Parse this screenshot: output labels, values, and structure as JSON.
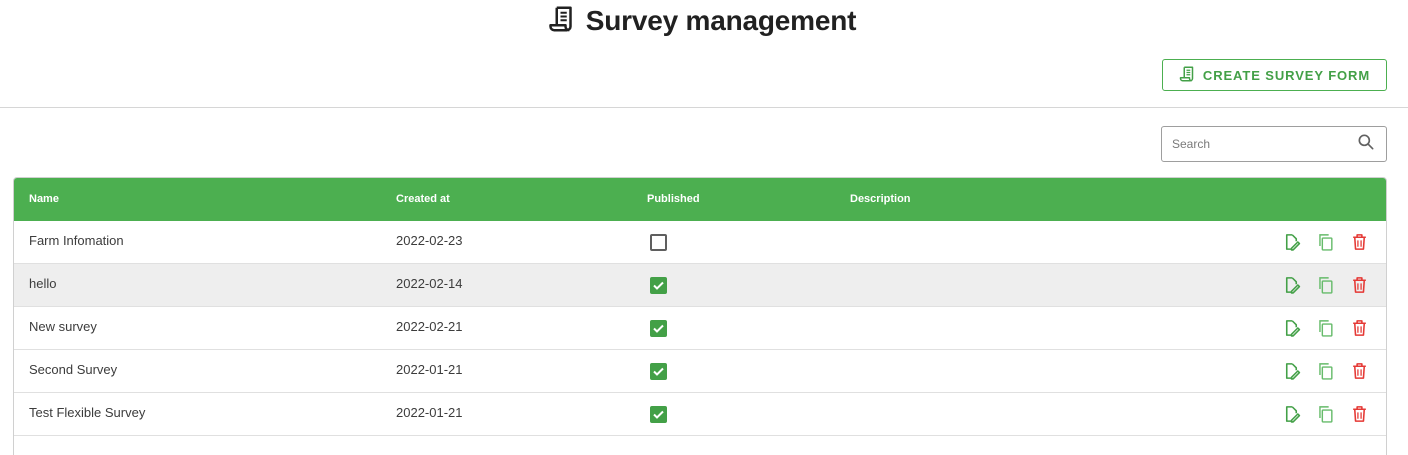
{
  "header": {
    "title": "Survey management",
    "icon": "survey-document-icon"
  },
  "toolbar": {
    "create_label": "CREATE SURVEY FORM",
    "create_icon": "survey-document-icon"
  },
  "search": {
    "placeholder": "Search",
    "value": "",
    "icon": "search-icon"
  },
  "table": {
    "columns": [
      "Name",
      "Created at",
      "Published",
      "Description"
    ],
    "rows": [
      {
        "name": "Farm Infomation",
        "created_at": "2022-02-23",
        "published": false,
        "description": ""
      },
      {
        "name": "hello",
        "created_at": "2022-02-14",
        "published": true,
        "description": ""
      },
      {
        "name": "New survey",
        "created_at": "2022-02-21",
        "published": true,
        "description": ""
      },
      {
        "name": "Second Survey",
        "created_at": "2022-01-21",
        "published": true,
        "description": ""
      },
      {
        "name": "Test Flexible Survey",
        "created_at": "2022-01-21",
        "published": true,
        "description": ""
      }
    ],
    "row_actions": [
      "edit-icon",
      "copy-icon",
      "delete-icon"
    ]
  },
  "colors": {
    "accent": "#4caf50",
    "delete": "#e53935",
    "header_text": "#ffffff",
    "row_alt": "#eeeeee"
  }
}
